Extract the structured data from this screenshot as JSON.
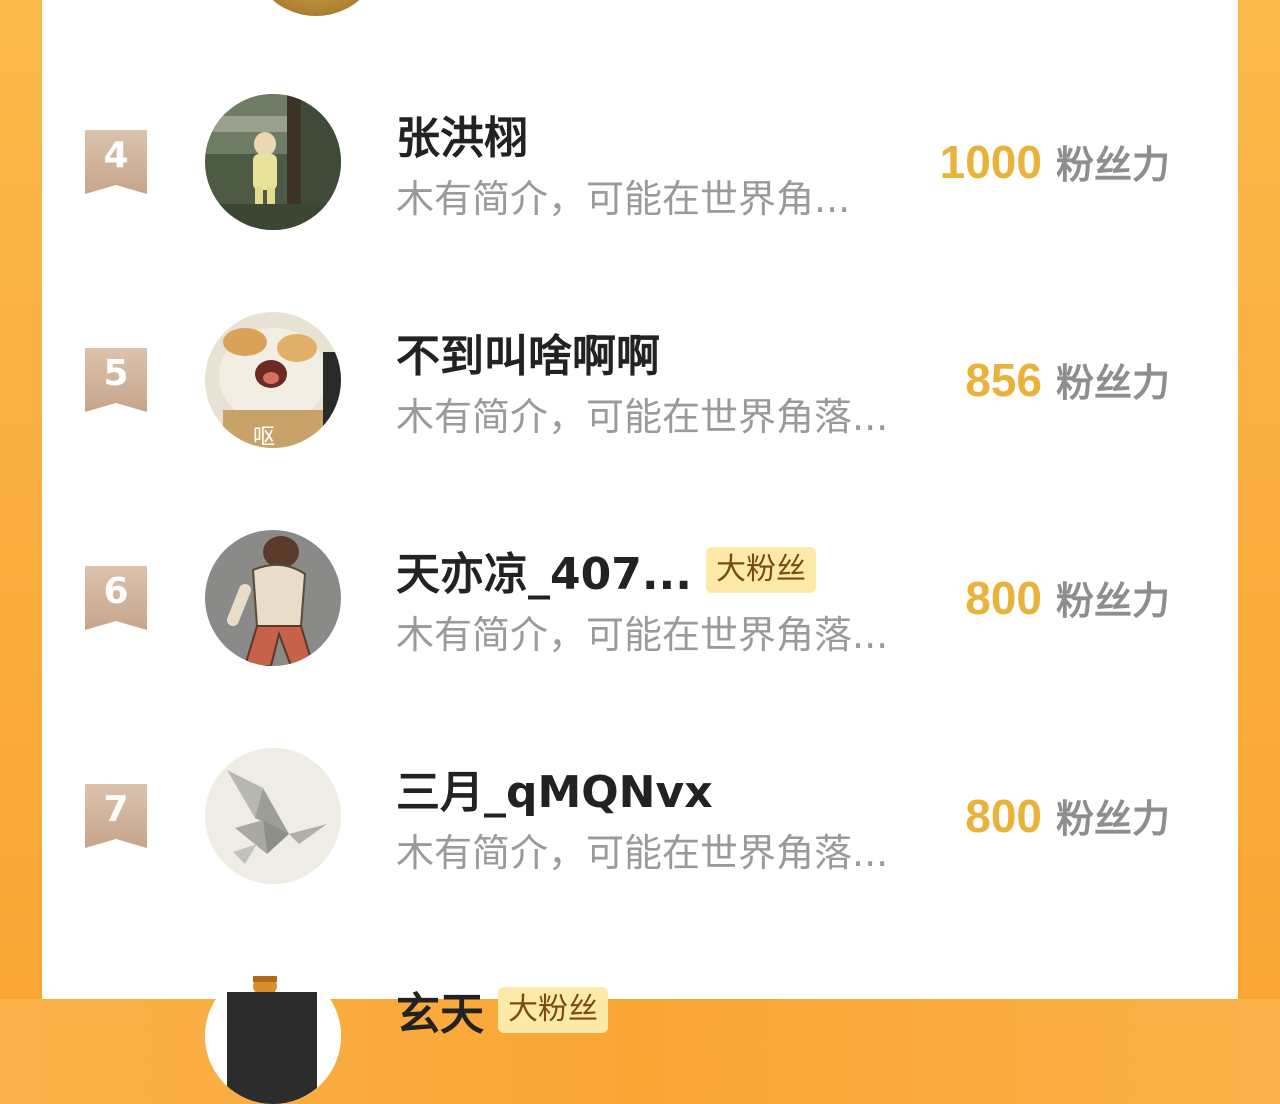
{
  "colors": {
    "accent_orange": "#f9a534",
    "score_gold": "#e9b23a",
    "rank_badge": "#d2b59d",
    "fan_badge_bg": "#fdeaa9",
    "fan_badge_text": "#7a4a12"
  },
  "ranking": {
    "rows": [
      {
        "rank": "4",
        "name": "张洪栩",
        "intro": "木有简介，可能在世界角...",
        "score": "1000",
        "score_unit": "粉丝力",
        "badge": "",
        "avatar_icon": "child-photo-avatar-icon"
      },
      {
        "rank": "5",
        "name": "不到叫啥啊啊",
        "intro": "木有简介，可能在世界角落...",
        "score": "856",
        "score_unit": "粉丝力",
        "badge": "",
        "avatar_icon": "screaming-cat-avatar-icon"
      },
      {
        "rank": "6",
        "name": "天亦凉_407...",
        "intro": "木有简介，可能在世界角落...",
        "score": "800",
        "score_unit": "粉丝力",
        "badge": "大粉丝",
        "avatar_icon": "cartoon-person-avatar-icon"
      },
      {
        "rank": "7",
        "name": "三月_qMQNvx",
        "intro": "木有简介，可能在世界角落...",
        "score": "800",
        "score_unit": "粉丝力",
        "badge": "",
        "avatar_icon": "origami-bird-avatar-icon"
      }
    ],
    "next_partial": {
      "name": "玄天",
      "badge": "大粉丝",
      "avatar_icon": "crown-avatar-icon"
    }
  }
}
